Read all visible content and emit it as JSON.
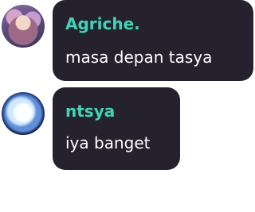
{
  "messages": [
    {
      "username": "Agriche.",
      "text": "masa depan tasya",
      "username_color": "#3fd4b6",
      "avatar_icon": "user-avatar-anime-girl"
    },
    {
      "username": "ntsya",
      "text": "iya banget",
      "username_color": "#3fd4b6",
      "avatar_icon": "user-avatar-blue-glow"
    }
  ],
  "colors": {
    "bubble_background": "#25222e",
    "message_text": "#ffffff",
    "page_background": "#ffffff"
  }
}
